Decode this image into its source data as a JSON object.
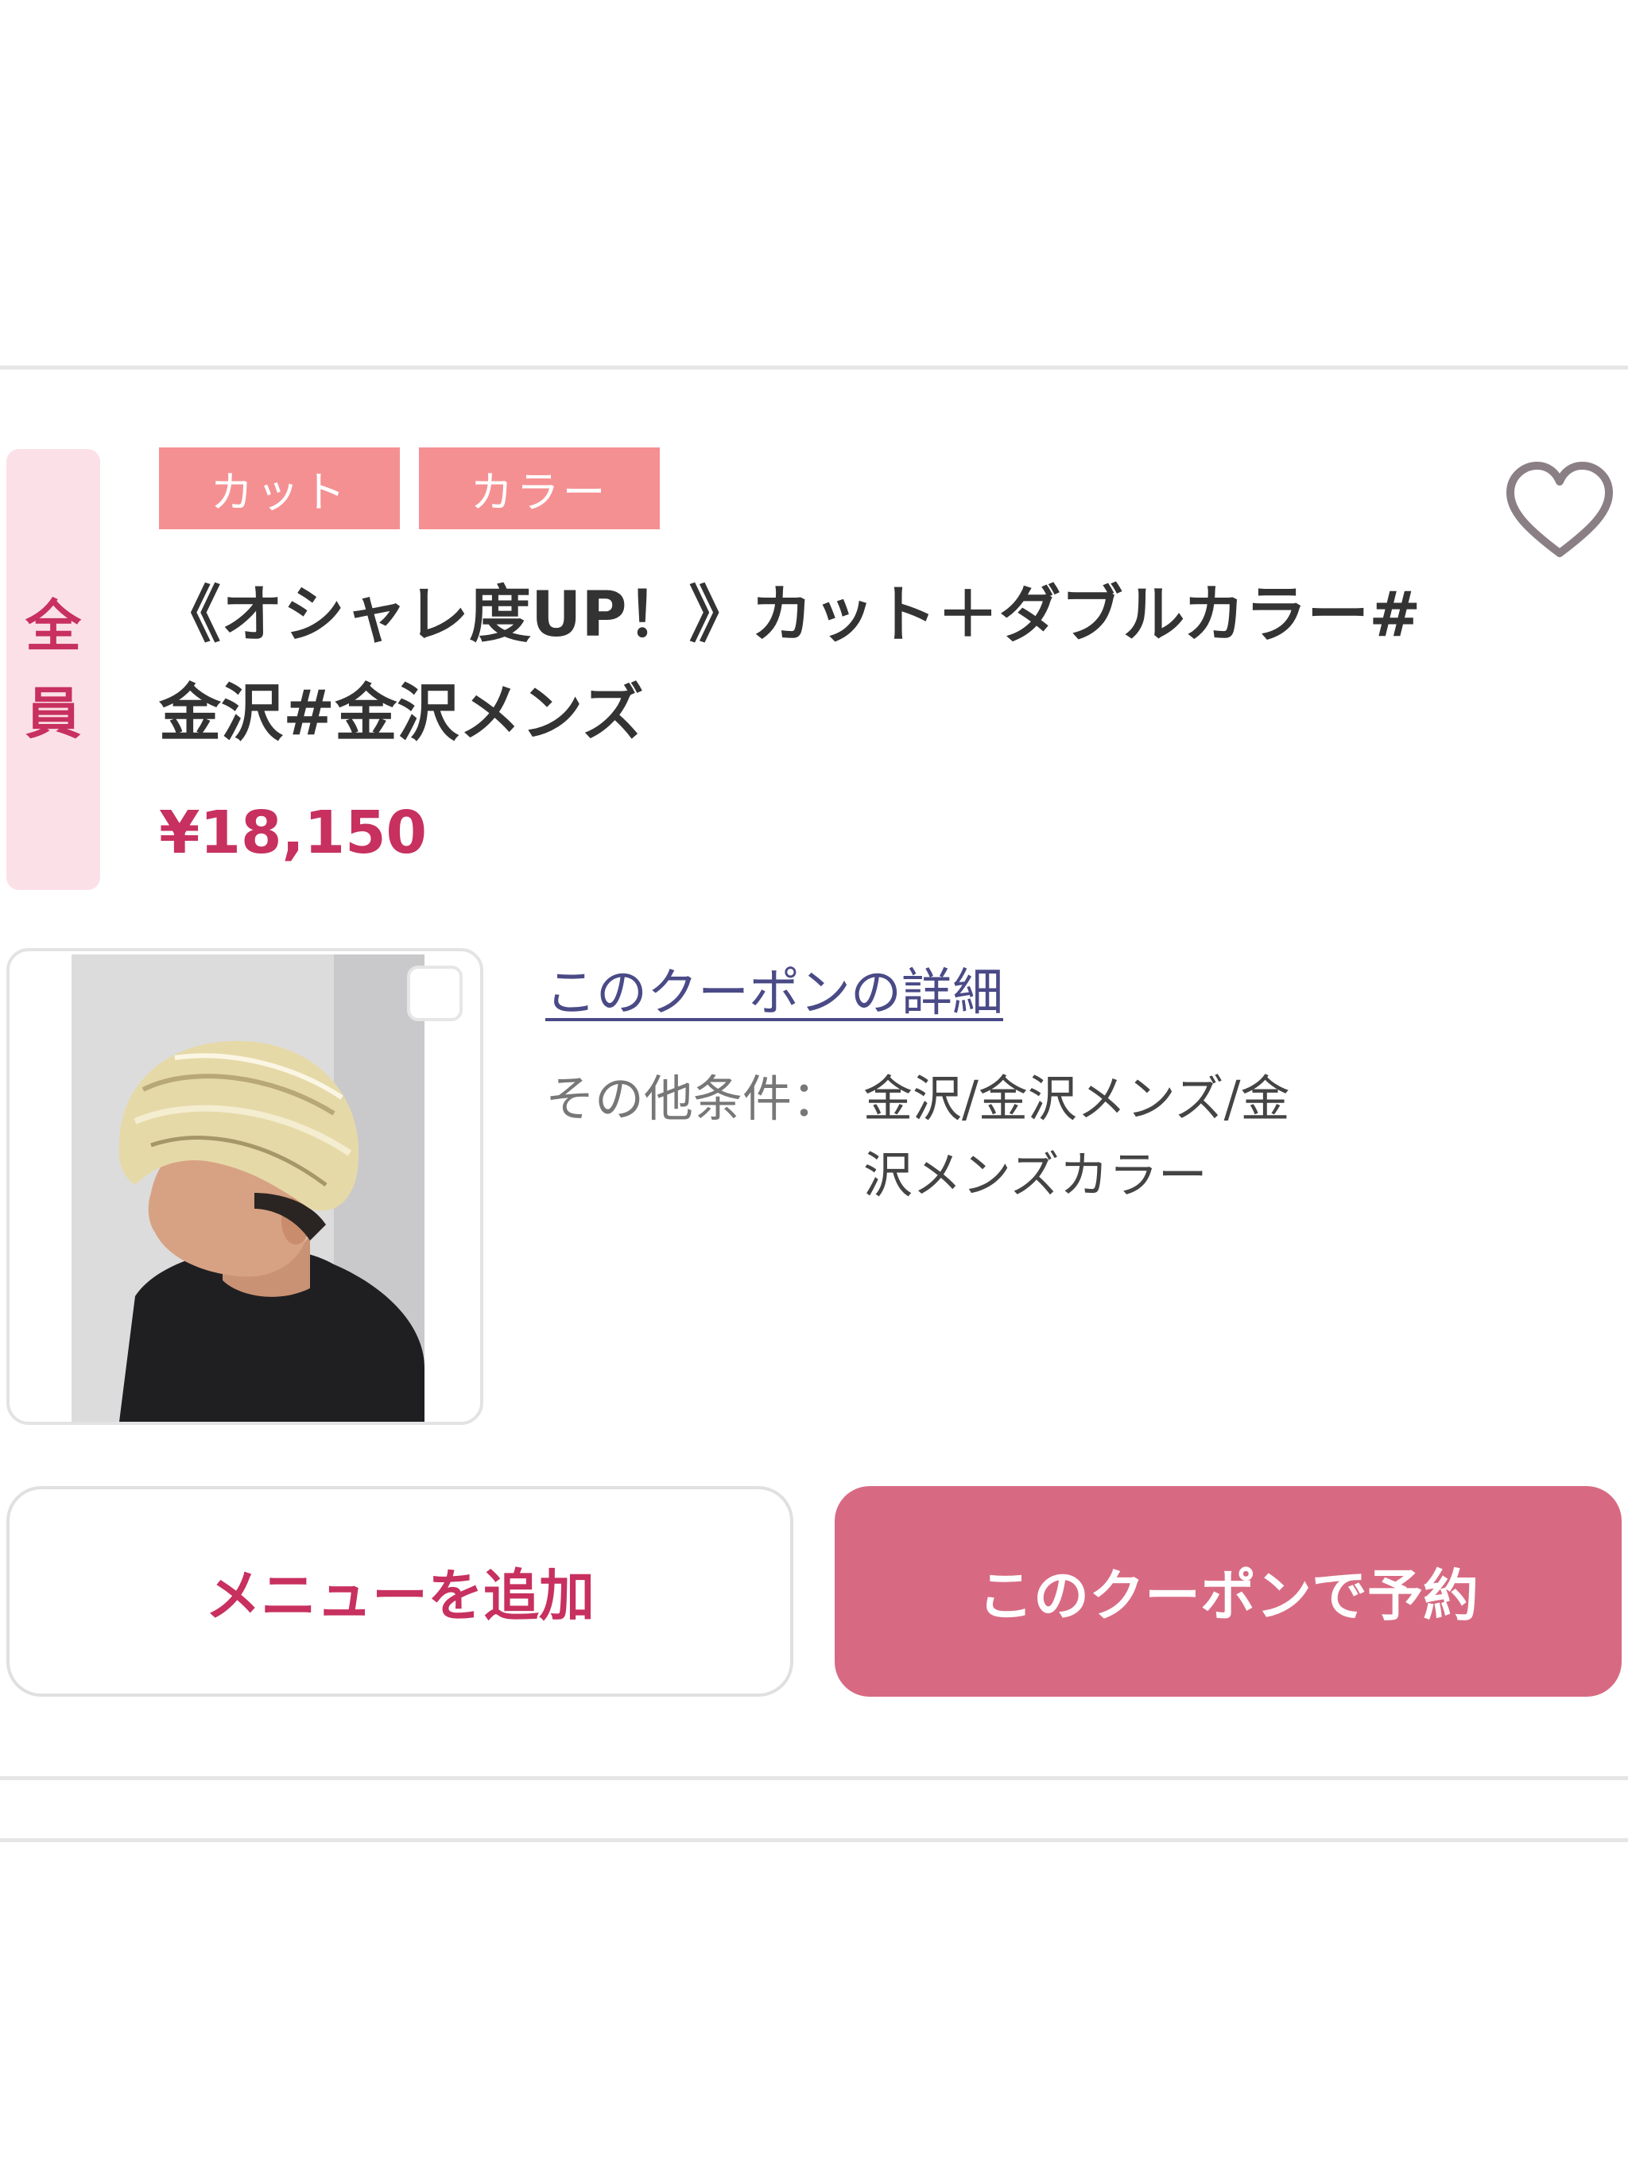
{
  "coupon": {
    "target": [
      "全",
      "員"
    ],
    "tags": [
      "カット",
      "カラー"
    ],
    "title": "《オシャレ度UP！》カット＋ダブルカラー#金沢#金沢メンズ",
    "price": "¥18,150",
    "detail_link": "このクーポンの詳細",
    "conditions_label": "その他条件：",
    "conditions_value": "金沢/金沢メンズ/金沢メンズカラー"
  },
  "actions": {
    "add_menu": "メニューを追加",
    "reserve": "このクーポンで予約"
  },
  "icons": {
    "favorite": "heart-outline-icon"
  },
  "colors": {
    "accent": "#c7305f",
    "tag_bg": "#f59092",
    "badge_bg": "#fbe1e7",
    "reserve_bg": "#d76a82",
    "link": "#4a4a87"
  }
}
